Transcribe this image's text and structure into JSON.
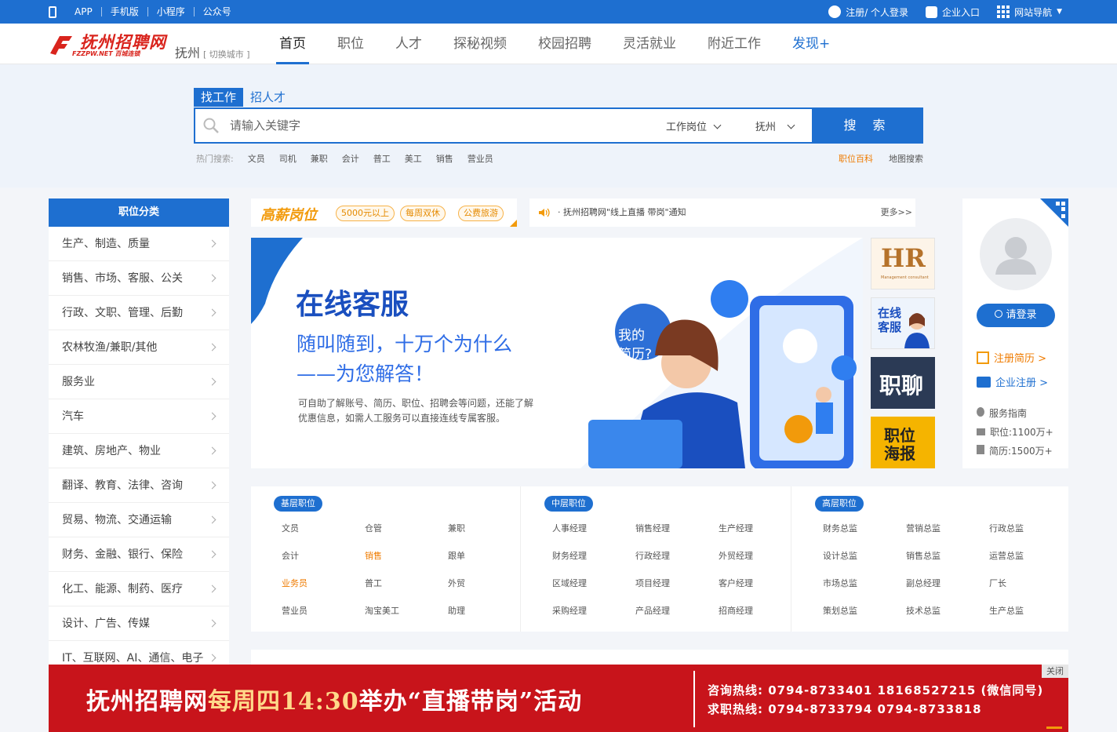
{
  "topbar": {
    "left": [
      "APP",
      "手机版",
      "小程序",
      "公众号"
    ],
    "login": "注册/ 个人登录",
    "enterprise": "企业入口",
    "sitenav": "网站导航"
  },
  "header": {
    "logo_title": "抚州招聘网",
    "logo_sub": "FZZPW.NET 百城连锁",
    "city": "抚州",
    "switch_city": "[ 切换城市 ]",
    "nav": [
      "首页",
      "职位",
      "人才",
      "探秘视频",
      "校园招聘",
      "灵活就业",
      "附近工作",
      "发现+"
    ]
  },
  "search": {
    "tab_job": "找工作",
    "tab_talent": "招人才",
    "placeholder": "请输入关键字",
    "type": "工作岗位",
    "city": "抚州",
    "button": "搜 索",
    "hot_label": "热门搜索:",
    "hot_keys": [
      "文员",
      "司机",
      "兼职",
      "会计",
      "普工",
      "美工",
      "销售",
      "营业员"
    ],
    "encyclopedia": "职位百科",
    "map": "地图搜索"
  },
  "categories": {
    "title": "职位分类",
    "items": [
      "生产、制造、质量",
      "销售、市场、客服、公关",
      "行政、文职、管理、后勤",
      "农林牧渔/兼职/其他",
      "服务业",
      "汽车",
      "建筑、房地产、物业",
      "翻译、教育、法律、咨询",
      "贸易、物流、交通运输",
      "财务、金融、银行、保险",
      "化工、能源、制药、医疗",
      "设计、广告、传媒",
      "IT、互联网、AI、通信、电子"
    ]
  },
  "promo": {
    "title": "高薪岗位",
    "tags": [
      "5000元以上",
      "每周双休",
      "公费旅游"
    ]
  },
  "notice": {
    "text": "· 抚州招聘网\"线上直播 带岗\"通知",
    "more": "更多>>"
  },
  "banner": {
    "title": "在线客服",
    "sub1": "随叫随到，十万个为什么",
    "sub2": "——为您解答！",
    "desc1": "可自助了解账号、简历、职位、招聘会等问题，还能了解",
    "desc2": "优惠信息，如需人工服务可以直接连线专属客服。",
    "bubble1": "我的",
    "bubble2": "简历?"
  },
  "side_tiles": {
    "hr": "HR",
    "hr_sub": "Management consultant",
    "kefu": "在线客服",
    "zhiliao": "职聊",
    "poster": "职位海报"
  },
  "profile": {
    "login": "请登录",
    "register_resume": "注册简历 >",
    "register_company": "企业注册 >",
    "service": "服务指南",
    "jobs": "职位:1100万+",
    "resumes": "简历:1500万+"
  },
  "positions": [
    {
      "label": "基层职位",
      "items": [
        "文员",
        "仓管",
        "兼职",
        "会计",
        "销售",
        "跟单",
        "业务员",
        "普工",
        "外贸",
        "营业员",
        "淘宝美工",
        "助理"
      ],
      "highlight": [
        "销售",
        "业务员"
      ]
    },
    {
      "label": "中层职位",
      "items": [
        "人事经理",
        "销售经理",
        "生产经理",
        "财务经理",
        "行政经理",
        "外贸经理",
        "区域经理",
        "项目经理",
        "客户经理",
        "采购经理",
        "产品经理",
        "招商经理"
      ],
      "highlight": []
    },
    {
      "label": "高层职位",
      "items": [
        "财务总监",
        "营销总监",
        "行政总监",
        "设计总监",
        "销售总监",
        "运营总监",
        "市场总监",
        "副总经理",
        "厂长",
        "策划总监",
        "技术总监",
        "生产总监"
      ],
      "highlight": []
    }
  ],
  "adbar": {
    "part1": "抚州招聘网",
    "part2": "每周四14:30",
    "part3": "举办“直播带岗”活动",
    "hotline1": "咨询热线: 0794-8733401  18168527215 (微信同号)",
    "hotline2": "求职热线: 0794-8733794  0794-8733818",
    "close": "关闭"
  },
  "colors": {
    "primary": "#1e6fd0",
    "red": "#c8141b",
    "orange": "#ef7b00"
  }
}
